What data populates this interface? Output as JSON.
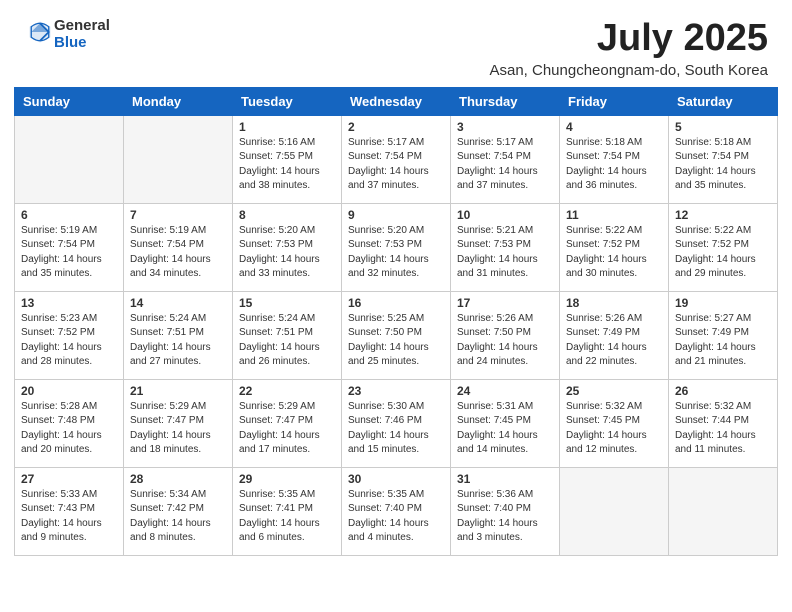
{
  "header": {
    "logo_general": "General",
    "logo_blue": "Blue",
    "month_year": "July 2025",
    "location": "Asan, Chungcheongnam-do, South Korea"
  },
  "days_of_week": [
    "Sunday",
    "Monday",
    "Tuesday",
    "Wednesday",
    "Thursday",
    "Friday",
    "Saturday"
  ],
  "weeks": [
    [
      {
        "num": "",
        "info": ""
      },
      {
        "num": "",
        "info": ""
      },
      {
        "num": "1",
        "info": "Sunrise: 5:16 AM\nSunset: 7:55 PM\nDaylight: 14 hours and 38 minutes."
      },
      {
        "num": "2",
        "info": "Sunrise: 5:17 AM\nSunset: 7:54 PM\nDaylight: 14 hours and 37 minutes."
      },
      {
        "num": "3",
        "info": "Sunrise: 5:17 AM\nSunset: 7:54 PM\nDaylight: 14 hours and 37 minutes."
      },
      {
        "num": "4",
        "info": "Sunrise: 5:18 AM\nSunset: 7:54 PM\nDaylight: 14 hours and 36 minutes."
      },
      {
        "num": "5",
        "info": "Sunrise: 5:18 AM\nSunset: 7:54 PM\nDaylight: 14 hours and 35 minutes."
      }
    ],
    [
      {
        "num": "6",
        "info": "Sunrise: 5:19 AM\nSunset: 7:54 PM\nDaylight: 14 hours and 35 minutes."
      },
      {
        "num": "7",
        "info": "Sunrise: 5:19 AM\nSunset: 7:54 PM\nDaylight: 14 hours and 34 minutes."
      },
      {
        "num": "8",
        "info": "Sunrise: 5:20 AM\nSunset: 7:53 PM\nDaylight: 14 hours and 33 minutes."
      },
      {
        "num": "9",
        "info": "Sunrise: 5:20 AM\nSunset: 7:53 PM\nDaylight: 14 hours and 32 minutes."
      },
      {
        "num": "10",
        "info": "Sunrise: 5:21 AM\nSunset: 7:53 PM\nDaylight: 14 hours and 31 minutes."
      },
      {
        "num": "11",
        "info": "Sunrise: 5:22 AM\nSunset: 7:52 PM\nDaylight: 14 hours and 30 minutes."
      },
      {
        "num": "12",
        "info": "Sunrise: 5:22 AM\nSunset: 7:52 PM\nDaylight: 14 hours and 29 minutes."
      }
    ],
    [
      {
        "num": "13",
        "info": "Sunrise: 5:23 AM\nSunset: 7:52 PM\nDaylight: 14 hours and 28 minutes."
      },
      {
        "num": "14",
        "info": "Sunrise: 5:24 AM\nSunset: 7:51 PM\nDaylight: 14 hours and 27 minutes."
      },
      {
        "num": "15",
        "info": "Sunrise: 5:24 AM\nSunset: 7:51 PM\nDaylight: 14 hours and 26 minutes."
      },
      {
        "num": "16",
        "info": "Sunrise: 5:25 AM\nSunset: 7:50 PM\nDaylight: 14 hours and 25 minutes."
      },
      {
        "num": "17",
        "info": "Sunrise: 5:26 AM\nSunset: 7:50 PM\nDaylight: 14 hours and 24 minutes."
      },
      {
        "num": "18",
        "info": "Sunrise: 5:26 AM\nSunset: 7:49 PM\nDaylight: 14 hours and 22 minutes."
      },
      {
        "num": "19",
        "info": "Sunrise: 5:27 AM\nSunset: 7:49 PM\nDaylight: 14 hours and 21 minutes."
      }
    ],
    [
      {
        "num": "20",
        "info": "Sunrise: 5:28 AM\nSunset: 7:48 PM\nDaylight: 14 hours and 20 minutes."
      },
      {
        "num": "21",
        "info": "Sunrise: 5:29 AM\nSunset: 7:47 PM\nDaylight: 14 hours and 18 minutes."
      },
      {
        "num": "22",
        "info": "Sunrise: 5:29 AM\nSunset: 7:47 PM\nDaylight: 14 hours and 17 minutes."
      },
      {
        "num": "23",
        "info": "Sunrise: 5:30 AM\nSunset: 7:46 PM\nDaylight: 14 hours and 15 minutes."
      },
      {
        "num": "24",
        "info": "Sunrise: 5:31 AM\nSunset: 7:45 PM\nDaylight: 14 hours and 14 minutes."
      },
      {
        "num": "25",
        "info": "Sunrise: 5:32 AM\nSunset: 7:45 PM\nDaylight: 14 hours and 12 minutes."
      },
      {
        "num": "26",
        "info": "Sunrise: 5:32 AM\nSunset: 7:44 PM\nDaylight: 14 hours and 11 minutes."
      }
    ],
    [
      {
        "num": "27",
        "info": "Sunrise: 5:33 AM\nSunset: 7:43 PM\nDaylight: 14 hours and 9 minutes."
      },
      {
        "num": "28",
        "info": "Sunrise: 5:34 AM\nSunset: 7:42 PM\nDaylight: 14 hours and 8 minutes."
      },
      {
        "num": "29",
        "info": "Sunrise: 5:35 AM\nSunset: 7:41 PM\nDaylight: 14 hours and 6 minutes."
      },
      {
        "num": "30",
        "info": "Sunrise: 5:35 AM\nSunset: 7:40 PM\nDaylight: 14 hours and 4 minutes."
      },
      {
        "num": "31",
        "info": "Sunrise: 5:36 AM\nSunset: 7:40 PM\nDaylight: 14 hours and 3 minutes."
      },
      {
        "num": "",
        "info": ""
      },
      {
        "num": "",
        "info": ""
      }
    ]
  ]
}
